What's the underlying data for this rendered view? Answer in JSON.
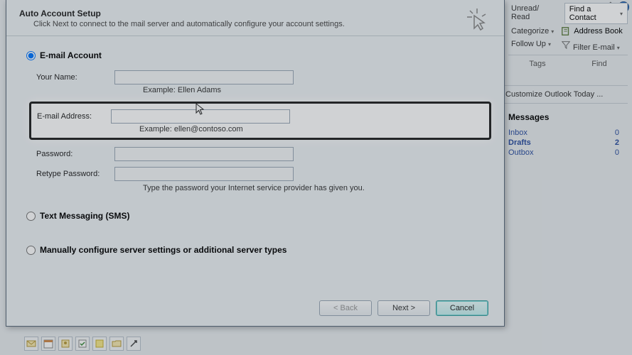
{
  "help_icon_label": "?",
  "ribbon": {
    "unread_read": "Unread/ Read",
    "find_contact": "Find a Contact",
    "categorize": "Categorize",
    "address_book": "Address Book",
    "follow_up": "Follow Up",
    "filter_email": "Filter E-mail",
    "group_tags": "Tags",
    "group_find": "Find"
  },
  "side_panel": {
    "customize_link": "Customize Outlook Today ...",
    "messages_heading": "Messages",
    "items": [
      {
        "name": "Inbox",
        "count": "0",
        "bold": false
      },
      {
        "name": "Drafts",
        "count": "2",
        "bold": true
      },
      {
        "name": "Outbox",
        "count": "0",
        "bold": false
      }
    ]
  },
  "dialog": {
    "title": "Auto Account Setup",
    "subtitle": "Click Next to connect to the mail server and automatically configure your account settings.",
    "email_account_label": "E-mail Account",
    "your_name_label": "Your Name:",
    "your_name_value": "",
    "your_name_hint": "Example: Ellen Adams",
    "email_label": "E-mail Address:",
    "email_value": "",
    "email_hint": "Example: ellen@contoso.com",
    "password_label": "Password:",
    "password_value": "",
    "retype_password_label": "Retype Password:",
    "retype_password_value": "",
    "password_hint": "Type the password your Internet service provider has given you.",
    "sms_label": "Text Messaging (SMS)",
    "manual_label": "Manually configure server settings or additional server types",
    "back_btn": "< Back",
    "next_btn": "Next >",
    "cancel_btn": "Cancel"
  },
  "taskbar_icons": [
    "mail-icon",
    "calendar-icon",
    "contacts-icon",
    "tasks-icon",
    "notes-icon",
    "folder-icon",
    "shortcuts-icon"
  ]
}
